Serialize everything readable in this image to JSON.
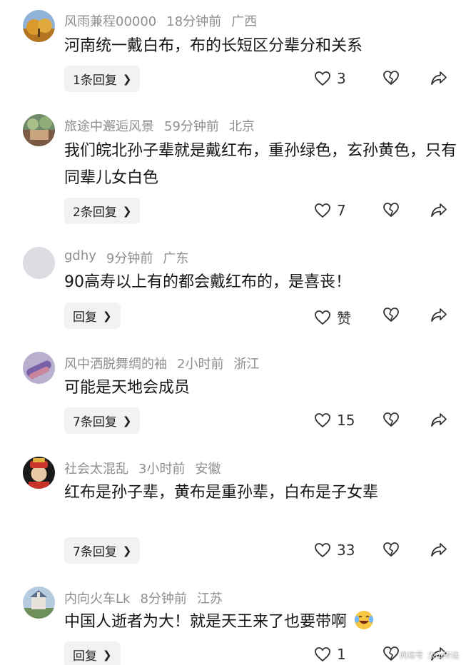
{
  "comments": [
    {
      "username": "风雨兼程00000",
      "time": "18分钟前",
      "location": "广西",
      "text": "河南统一戴白布，布的长短区分辈分和关系",
      "reply_label": "1条回复",
      "likes": "3",
      "avatar_color": "#c6902f"
    },
    {
      "username": "旅途中邂逅风景",
      "time": "59分钟前",
      "location": "北京",
      "text": "我们皖北孙子辈就是戴红布，重孙绿色，玄孙黄色，只有同辈儿女白色",
      "reply_label": "2条回复",
      "likes": "7",
      "avatar_color": "#8a6d5a"
    },
    {
      "username": "gdhy",
      "time": "9分钟前",
      "location": "广东",
      "text": "90高寿以上有的都会戴红布的，是喜丧！",
      "reply_label": "回复",
      "likes": "赞",
      "avatar_color": "#dcdce2"
    },
    {
      "username": "风中洒脱舞绸的袖",
      "time": "2小时前",
      "location": "浙江",
      "text": "可能是天地会成员",
      "reply_label": "7条回复",
      "likes": "15",
      "avatar_color": "#9a88b8"
    },
    {
      "username": "社会太混乱",
      "time": "3小时前",
      "location": "安徽",
      "text": "红布是孙子辈，黄布是重孙辈，白布是子女辈",
      "reply_label": "7条回复",
      "likes": "33",
      "avatar_color": "#2a2a2a"
    },
    {
      "username": "内向火车Lk",
      "time": "8分钟前",
      "location": "江苏",
      "text": "中国人逝者为大！就是天王来了也要带啊",
      "reply_label": "回复",
      "likes": "1",
      "avatar_color": "#a3b7c9"
    }
  ],
  "watermark": {
    "left": "网易号",
    "right": "太山砖话"
  },
  "icons": {
    "like": "heart-outline-icon",
    "dislike": "broken-heart-icon",
    "share": "share-arrow-icon",
    "chevron": "chevron-right-icon"
  }
}
